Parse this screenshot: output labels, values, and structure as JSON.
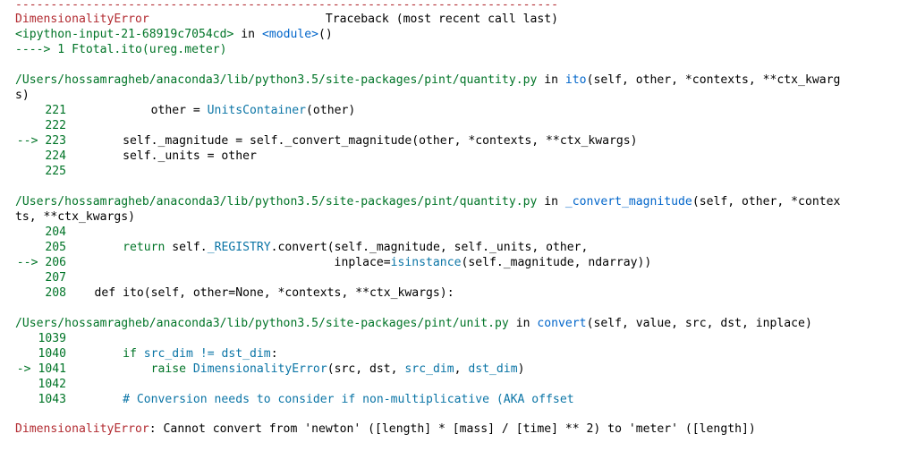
{
  "traceback": {
    "separator": "-----------------------------------------------------------------------------",
    "error_name": "DimensionalityError",
    "header_gap": "                         ",
    "header_title": "Traceback (most recent call last)",
    "input_ref": "<ipython-input-21-68919c7054cd>",
    "in_word": " in ",
    "module_ref": "<module>",
    "module_suffix": "()",
    "call_line": "----> 1 Ftotal.ito(ureg.meter)",
    "frames": [
      {
        "path": "/Users/hossamragheb/anaconda3/lib/python3.5/site-packages/pint/quantity.py",
        "in_word": " in ",
        "func": "ito",
        "args_line1": "(self, other, *contexts, **ctx_kwarg",
        "args_line2": "s)",
        "lines": [
          {
            "marker": "",
            "num": "221",
            "code": "            other = UnitsContainer(other)"
          },
          {
            "marker": "",
            "num": "222",
            "code": ""
          },
          {
            "marker": "--> ",
            "num": "223",
            "code": "        self._magnitude = self._convert_magnitude(other, *contexts, **ctx_kwargs)"
          },
          {
            "marker": "",
            "num": "224",
            "code": "        self._units = other"
          },
          {
            "marker": "",
            "num": "225",
            "code": ""
          }
        ]
      },
      {
        "path": "/Users/hossamragheb/anaconda3/lib/python3.5/site-packages/pint/quantity.py",
        "in_word": " in ",
        "func": "_convert_magnitude",
        "args_line1": "(self, other, *contex",
        "args_line2": "ts, **ctx_kwargs)",
        "lines": [
          {
            "marker": "",
            "num": "204",
            "code": ""
          },
          {
            "marker": "",
            "num": "205",
            "code": "        return self._REGISTRY.convert(self._magnitude, self._units, other,"
          },
          {
            "marker": "--> ",
            "num": "206",
            "code": "                                      inplace=isinstance(self._magnitude, ndarray))"
          },
          {
            "marker": "",
            "num": "207",
            "code": ""
          },
          {
            "marker": "",
            "num": "208",
            "code": "    def ito(self, other=None, *contexts, **ctx_kwargs):"
          }
        ]
      },
      {
        "path": "/Users/hossamragheb/anaconda3/lib/python3.5/site-packages/pint/unit.py",
        "in_word": " in ",
        "func": "convert",
        "args_line1": "(self, value, src, dst, inplace)",
        "args_line2": "",
        "lines": [
          {
            "marker": "",
            "num": "1039",
            "code": ""
          },
          {
            "marker": "",
            "num": "1040",
            "code": "        if src_dim != dst_dim:"
          },
          {
            "marker": "-> ",
            "num": "1041",
            "code": "            raise DimensionalityError(src, dst, src_dim, dst_dim)"
          },
          {
            "marker": "",
            "num": "1042",
            "code": ""
          },
          {
            "marker": "",
            "num": "1043",
            "code": "        # Conversion needs to consider if non-multiplicative (AKA offset"
          }
        ]
      }
    ],
    "final_error_name": "DimensionalityError",
    "final_message": ": Cannot convert from 'newton' ([length] * [mass] / [time] ** 2) to 'meter' ([length])"
  },
  "colors": {
    "error_red": "#b22b31",
    "path_green": "#007427",
    "func_blue": "#0065ca",
    "code_cyan": "#0b75a6",
    "text": "#000000",
    "background": "#ffffff"
  }
}
